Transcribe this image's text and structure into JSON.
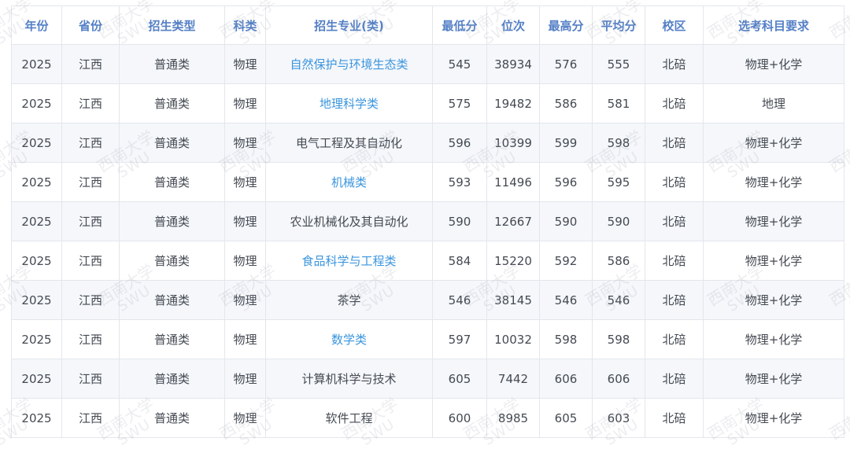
{
  "table": {
    "headers": [
      "年份",
      "省份",
      "招生类型",
      "科类",
      "招生专业(类)",
      "最低分",
      "位次",
      "最高分",
      "平均分",
      "校区",
      "选考科目要求"
    ],
    "rows": [
      {
        "year": "2025",
        "province": "江西",
        "type": "普通类",
        "category": "物理",
        "major": "自然保护与环境生态类",
        "major_is_link": true,
        "min": "545",
        "rank": "38934",
        "max": "576",
        "avg": "555",
        "campus": "北碚",
        "subjects": "物理+化学"
      },
      {
        "year": "2025",
        "province": "江西",
        "type": "普通类",
        "category": "物理",
        "major": "地理科学类",
        "major_is_link": true,
        "min": "575",
        "rank": "19482",
        "max": "586",
        "avg": "581",
        "campus": "北碚",
        "subjects": "地理"
      },
      {
        "year": "2025",
        "province": "江西",
        "type": "普通类",
        "category": "物理",
        "major": "电气工程及其自动化",
        "major_is_link": false,
        "min": "596",
        "rank": "10399",
        "max": "599",
        "avg": "598",
        "campus": "北碚",
        "subjects": "物理+化学"
      },
      {
        "year": "2025",
        "province": "江西",
        "type": "普通类",
        "category": "物理",
        "major": "机械类",
        "major_is_link": true,
        "min": "593",
        "rank": "11496",
        "max": "596",
        "avg": "595",
        "campus": "北碚",
        "subjects": "物理+化学"
      },
      {
        "year": "2025",
        "province": "江西",
        "type": "普通类",
        "category": "物理",
        "major": "农业机械化及其自动化",
        "major_is_link": false,
        "min": "590",
        "rank": "12667",
        "max": "590",
        "avg": "590",
        "campus": "北碚",
        "subjects": "物理+化学"
      },
      {
        "year": "2025",
        "province": "江西",
        "type": "普通类",
        "category": "物理",
        "major": "食品科学与工程类",
        "major_is_link": true,
        "min": "584",
        "rank": "15220",
        "max": "592",
        "avg": "586",
        "campus": "北碚",
        "subjects": "物理+化学"
      },
      {
        "year": "2025",
        "province": "江西",
        "type": "普通类",
        "category": "物理",
        "major": "茶学",
        "major_is_link": false,
        "min": "546",
        "rank": "38145",
        "max": "546",
        "avg": "546",
        "campus": "北碚",
        "subjects": "物理+化学"
      },
      {
        "year": "2025",
        "province": "江西",
        "type": "普通类",
        "category": "物理",
        "major": "数学类",
        "major_is_link": true,
        "min": "597",
        "rank": "10032",
        "max": "598",
        "avg": "598",
        "campus": "北碚",
        "subjects": "物理+化学"
      },
      {
        "year": "2025",
        "province": "江西",
        "type": "普通类",
        "category": "物理",
        "major": "计算机科学与技术",
        "major_is_link": false,
        "min": "605",
        "rank": "7442",
        "max": "606",
        "avg": "606",
        "campus": "北碚",
        "subjects": "物理+化学"
      },
      {
        "year": "2025",
        "province": "江西",
        "type": "普通类",
        "category": "物理",
        "major": "软件工程",
        "major_is_link": false,
        "min": "600",
        "rank": "8985",
        "max": "605",
        "avg": "603",
        "campus": "北碚",
        "subjects": "物理+化学"
      }
    ]
  },
  "watermark": {
    "text_cn": "西南大学",
    "text_en": "SWU"
  },
  "colors": {
    "header_text": "#5580c6",
    "link": "#3a95de",
    "body_text": "#444a52",
    "stripe": "#f5f7fb",
    "border": "#e3e6ec"
  }
}
